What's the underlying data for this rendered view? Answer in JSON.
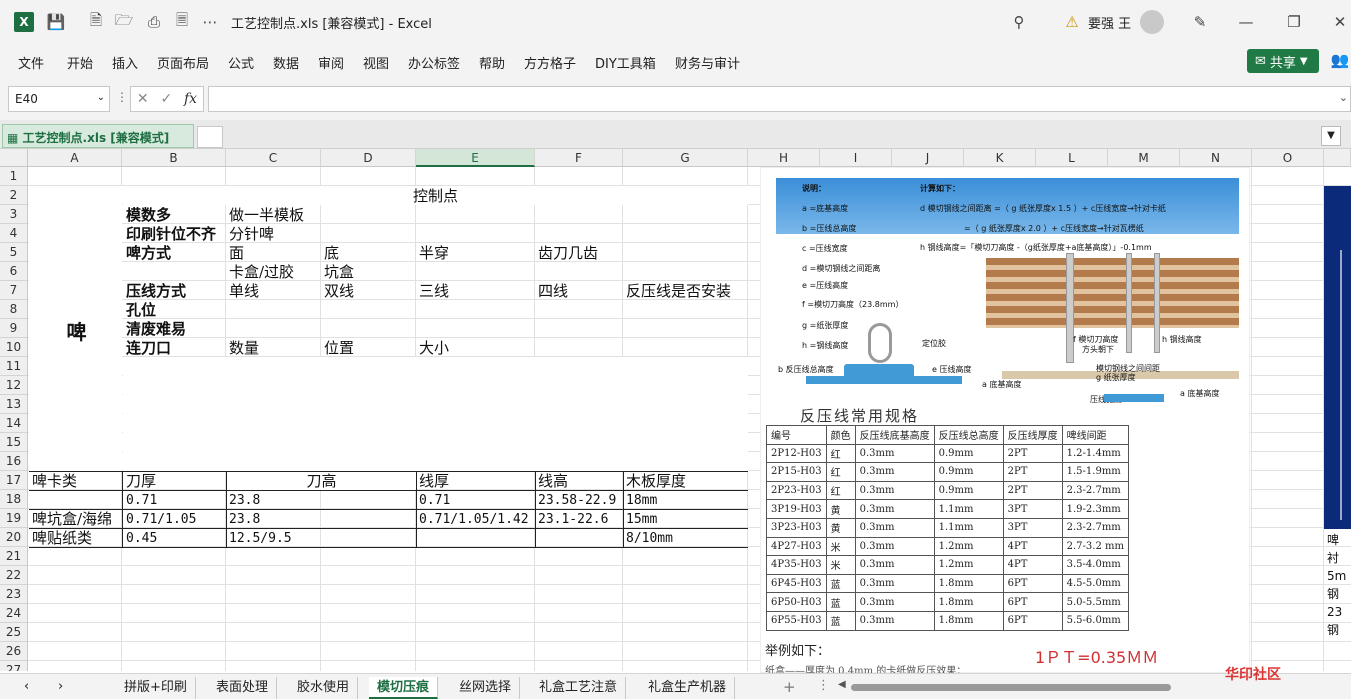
{
  "window": {
    "title": "工艺控制点.xls  [兼容模式]  -  Excel",
    "user": "要强 王"
  },
  "menu": [
    "文件",
    "开始",
    "插入",
    "页面布局",
    "公式",
    "数据",
    "审阅",
    "视图",
    "办公标签",
    "帮助",
    "方方格子",
    "DIY工具箱",
    "财务与审计"
  ],
  "share_label": "共享",
  "formula_bar": {
    "name_box": "E40",
    "fx": "fx",
    "formula": ""
  },
  "workbook_tab": "工艺控制点.xls  [兼容模式]",
  "columns": [
    "A",
    "B",
    "C",
    "D",
    "E",
    "F",
    "G",
    "H",
    "I",
    "J",
    "K",
    "L",
    "M",
    "N",
    "O"
  ],
  "selected_column": "E",
  "rows": [
    "1",
    "2",
    "3",
    "4",
    "5",
    "6",
    "7",
    "8",
    "9",
    "10",
    "11",
    "12",
    "13",
    "14",
    "15",
    "16",
    "17",
    "18",
    "19",
    "20",
    "21",
    "22",
    "23",
    "24",
    "25",
    "26",
    "27"
  ],
  "sheet": {
    "a_merged": "啤",
    "title": "控制点",
    "r3": [
      "模数多",
      "做一半模板"
    ],
    "r4": [
      "印刷针位不齐",
      "分针啤"
    ],
    "r5": [
      "啤方式",
      "面",
      "底",
      "半穿",
      "齿刀几齿"
    ],
    "r6": [
      "卡盒/过胶",
      "坑盒"
    ],
    "r7": [
      "压线方式",
      "单线",
      "双线",
      "三线",
      "四线",
      "反压线是否安装"
    ],
    "r8": "孔位",
    "r9": "清废难易",
    "r10": [
      "连刀口",
      "数量",
      "位置",
      "大小"
    ],
    "r17": [
      "啤卡类",
      "刀厚",
      "刀高",
      "线厚",
      "线高",
      "木板厚度"
    ],
    "r18": [
      "0.71",
      "23.8",
      "0.71",
      "23.58-22.9",
      "18mm"
    ],
    "r19": [
      "啤坑盒/海绵",
      "0.71/1.05",
      "23.8",
      "0.71/1.05/1.42",
      "23.1-22.6",
      "15mm"
    ],
    "r20": [
      "啤贴纸类",
      "0.45",
      "12.5/9.5",
      "8/10mm"
    ]
  },
  "picture": {
    "diagram_labels": {
      "desc": "说明：",
      "calc": "计算如下：",
      "a": "a =底基高度",
      "b": "b =压线总高度",
      "c": "c =压线宽度",
      "d": "d =模切钢线之间距离",
      "e": "e =压线高度",
      "f": "f =模切刀高度（23.8mm）",
      "g": "g =纸张厚度",
      "h": "h =钢线高度",
      "formula1": "d 模切钢线之间距离 =（ g 纸张厚度x 1.5 ）+ c压线宽度→针对卡纸",
      "formula2": "=（ g 纸张厚度x 2.0 ）+ c压线宽度→针对瓦楞纸",
      "formula3": "h 钢线高度=「模切刀高度 -（g纸张厚度+a底基高度）」-0.1mm",
      "pos_glue": "定位胶",
      "b_total": "b 反压线总高度",
      "e_height": "e 压线高度",
      "a_base": "a 底基高度",
      "f_knife": "f 模切刀高度",
      "direction": "方头朝下",
      "h_steel": "h 钢线高度",
      "paper": "g 纸张厚度",
      "gap": "模切钢线之间间距",
      "crease_width": "压线宽度",
      "a_base2": "a 底基高度"
    },
    "spec_title": "反压线常用规格",
    "spec_headers": [
      "编号",
      "颜色",
      "反压线底基高度",
      "反压线总高度",
      "反压线厚度",
      "啤线间距"
    ],
    "spec_rows": [
      [
        "2P12-H03",
        "红",
        "0.3mm",
        "0.9mm",
        "2PT",
        "1.2-1.4mm"
      ],
      [
        "2P15-H03",
        "红",
        "0.3mm",
        "0.9mm",
        "2PT",
        "1.5-1.9mm"
      ],
      [
        "2P23-H03",
        "红",
        "0.3mm",
        "0.9mm",
        "2PT",
        "2.3-2.7mm"
      ],
      [
        "3P19-H03",
        "黄",
        "0.3mm",
        "1.1mm",
        "3PT",
        "1.9-2.3mm"
      ],
      [
        "3P23-H03",
        "黄",
        "0.3mm",
        "1.1mm",
        "3PT",
        "2.3-2.7mm"
      ],
      [
        "4P27-H03",
        "米",
        "0.3mm",
        "1.2mm",
        "4PT",
        "2.7-3.2 mm"
      ],
      [
        "4P35-H03",
        "米",
        "0.3mm",
        "1.2mm",
        "4PT",
        "3.5-4.0mm"
      ],
      [
        "6P45-H03",
        "蓝",
        "0.3mm",
        "1.8mm",
        "6PT",
        "4.5-5.0mm"
      ],
      [
        "6P50-H03",
        "蓝",
        "0.3mm",
        "1.8mm",
        "6PT",
        "5.0-5.5mm"
      ],
      [
        "6P55-H03",
        "蓝",
        "0.3mm",
        "1.8mm",
        "6PT",
        "5.5-6.0mm"
      ]
    ],
    "example_label": "举例如下：",
    "example_formula": "1ＰＴ=0.35ＭＭ",
    "example_small": "纸盒——厚度为 0.4mm 的卡纸做反压效果："
  },
  "right_chars": [
    "啤",
    "衬",
    "5m",
    "钢",
    "23",
    "钢"
  ],
  "sheet_tabs": [
    "拼版+印刷",
    "表面处理",
    "胶水使用",
    "模切压痕",
    "丝网选择",
    "礼盒工艺注意",
    "礼盒生产机器"
  ],
  "active_sheet": "模切压痕",
  "watermark": "华印社区"
}
